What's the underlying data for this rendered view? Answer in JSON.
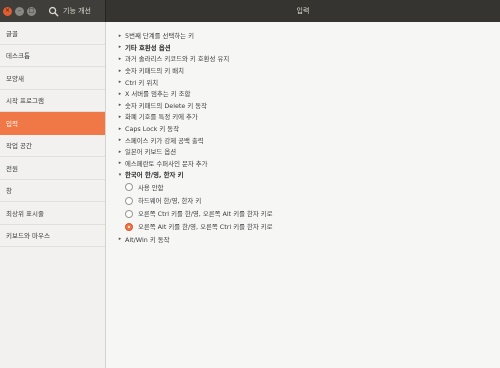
{
  "window": {
    "left_title": "기능 개선",
    "title": "입력"
  },
  "sidebar": {
    "items": [
      {
        "label": "글꼴",
        "active": false
      },
      {
        "label": "데스크톱",
        "active": false
      },
      {
        "label": "모양새",
        "active": false
      },
      {
        "label": "시작 프로그램",
        "active": false
      },
      {
        "label": "입력",
        "active": true
      },
      {
        "label": "작업 공간",
        "active": false
      },
      {
        "label": "전원",
        "active": false
      },
      {
        "label": "창",
        "active": false
      },
      {
        "label": "최상위 표시줄",
        "active": false
      },
      {
        "label": "키보드와 마우스",
        "active": false
      }
    ]
  },
  "options": [
    {
      "label": "5번째 단계를 선택하는 키",
      "bold": false,
      "arrow": "right"
    },
    {
      "label": "기타 호환성 옵션",
      "bold": true,
      "arrow": "right"
    },
    {
      "label": "과거 솔라리스 키코드와 키 호환성 유지",
      "bold": false,
      "arrow": "right"
    },
    {
      "label": "숫자 키패드의 키 배치",
      "bold": false,
      "arrow": "right"
    },
    {
      "label": "Ctrl 키 위치",
      "bold": false,
      "arrow": "right"
    },
    {
      "label": "X 서버를 멈추는 키 조합",
      "bold": false,
      "arrow": "right"
    },
    {
      "label": "숫자 키패드의 Delete 키 동작",
      "bold": false,
      "arrow": "right"
    },
    {
      "label": "화폐 기호를 특정 키에 추가",
      "bold": false,
      "arrow": "right"
    },
    {
      "label": "Caps Lock 키 동작",
      "bold": false,
      "arrow": "right"
    },
    {
      "label": "스페이스 키가 강제 공백 출력",
      "bold": false,
      "arrow": "right"
    },
    {
      "label": "일본어 키보드 옵션",
      "bold": false,
      "arrow": "right"
    },
    {
      "label": "에스페란토 수퍼사인 문자 추가",
      "bold": false,
      "arrow": "right"
    },
    {
      "label": "한국어 한/영, 한자 키",
      "bold": true,
      "arrow": "down"
    }
  ],
  "radio_group": [
    {
      "label": "사용 안함",
      "checked": false
    },
    {
      "label": "하드웨어 한/영, 한자 키",
      "checked": false
    },
    {
      "label": "오른쪽 Ctrl 키를 한/영, 오른쪽 Alt 키를 한자 키로",
      "checked": false
    },
    {
      "label": "오른쪽 Alt 키를 한/영, 오른쪽 Ctrl 키를 한자 키로",
      "checked": true
    }
  ],
  "trailing_options": [
    {
      "label": "Alt/Win 키 동작",
      "bold": false,
      "arrow": "right"
    }
  ],
  "icons": {
    "close": "close-icon",
    "minimize": "minimize-icon",
    "maximize": "maximize-icon",
    "search": "search-icon",
    "collapsed": "triangle-right-icon",
    "expanded": "triangle-down-icon"
  },
  "colors": {
    "accent": "#f07746",
    "titlebar": "#353431",
    "background": "#f6f6f5"
  }
}
